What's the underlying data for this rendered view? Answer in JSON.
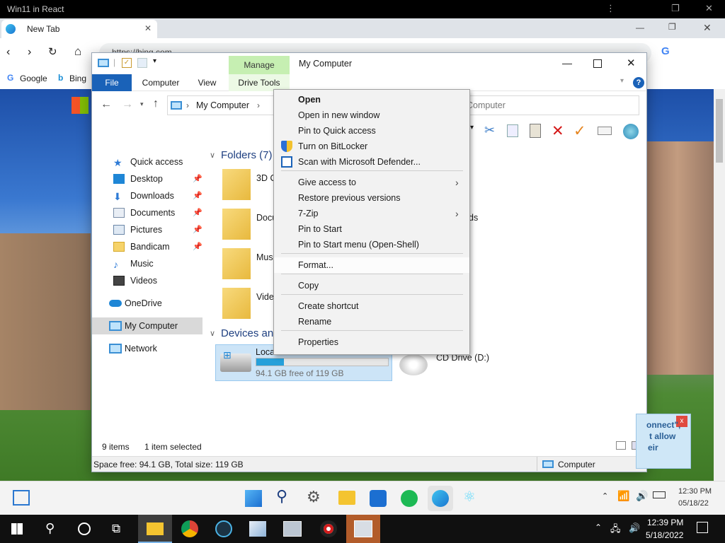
{
  "host": {
    "title": "Win11 in React"
  },
  "browser": {
    "tab_label": "New Tab",
    "address": "https://bing.com",
    "bookmarks": [
      {
        "label": "Google"
      },
      {
        "label": "Bing"
      }
    ]
  },
  "explorer": {
    "title": "My Computer",
    "ribbon": {
      "file": "File",
      "computer": "Computer",
      "view": "View",
      "manage": "Manage",
      "drive_tools": "Drive Tools"
    },
    "address_text": "My Computer",
    "search_placeholder": "Computer",
    "sidebar": [
      {
        "label": "Quick access",
        "pinned": false
      },
      {
        "label": "Desktop",
        "pinned": true
      },
      {
        "label": "Downloads",
        "pinned": true
      },
      {
        "label": "Documents",
        "pinned": true
      },
      {
        "label": "Pictures",
        "pinned": true
      },
      {
        "label": "Bandicam",
        "pinned": true
      },
      {
        "label": "Music",
        "pinned": false
      },
      {
        "label": "Videos",
        "pinned": false
      },
      {
        "label": "OneDrive",
        "pinned": false
      },
      {
        "label": "My Computer",
        "pinned": false
      },
      {
        "label": "Network",
        "pinned": false
      }
    ],
    "groups": {
      "folders": "Folders (7)",
      "devices": "Devices and"
    },
    "folders": [
      {
        "label": "3D O"
      },
      {
        "label": "Docu"
      },
      {
        "label": "Musi"
      },
      {
        "label": "Video"
      }
    ],
    "folder_right_label": "ds",
    "drives": {
      "c": {
        "label": "Loca",
        "free_text": "94.1 GB free of 119 GB",
        "used_fraction": 0.21
      },
      "d": {
        "label": "CD Drive (D:)"
      }
    },
    "status": {
      "items": "9 items",
      "selected": "1 item selected"
    },
    "status2": {
      "left": "Space free: 94.1 GB, Total size: 119 GB",
      "right": "Computer"
    }
  },
  "context_menu": {
    "items": [
      {
        "label": "Open",
        "bold": true
      },
      {
        "label": "Open in new window"
      },
      {
        "label": "Pin to Quick access"
      },
      {
        "label": "Turn on BitLocker",
        "icon": "shield-icon"
      },
      {
        "label": "Scan with Microsoft Defender...",
        "icon": "defender-icon"
      },
      {
        "label": "Give access to",
        "submenu": true
      },
      {
        "label": "Restore previous versions"
      },
      {
        "label": "7-Zip",
        "submenu": true
      },
      {
        "label": "Pin to Start"
      },
      {
        "label": "Pin to Start menu (Open-Shell)"
      },
      {
        "label": "Format...",
        "highlighted": true
      },
      {
        "label": "Copy"
      },
      {
        "label": "Create shortcut"
      },
      {
        "label": "Rename"
      },
      {
        "label": "Properties"
      }
    ]
  },
  "notification": {
    "line1": "onnect\",",
    "line2": "t allow",
    "line3": "eir"
  },
  "win11_taskbar": {
    "time": "12:30 PM",
    "date": "05/18/22"
  },
  "win10_taskbar": {
    "time": "12:39 PM",
    "date": "5/18/2022"
  }
}
